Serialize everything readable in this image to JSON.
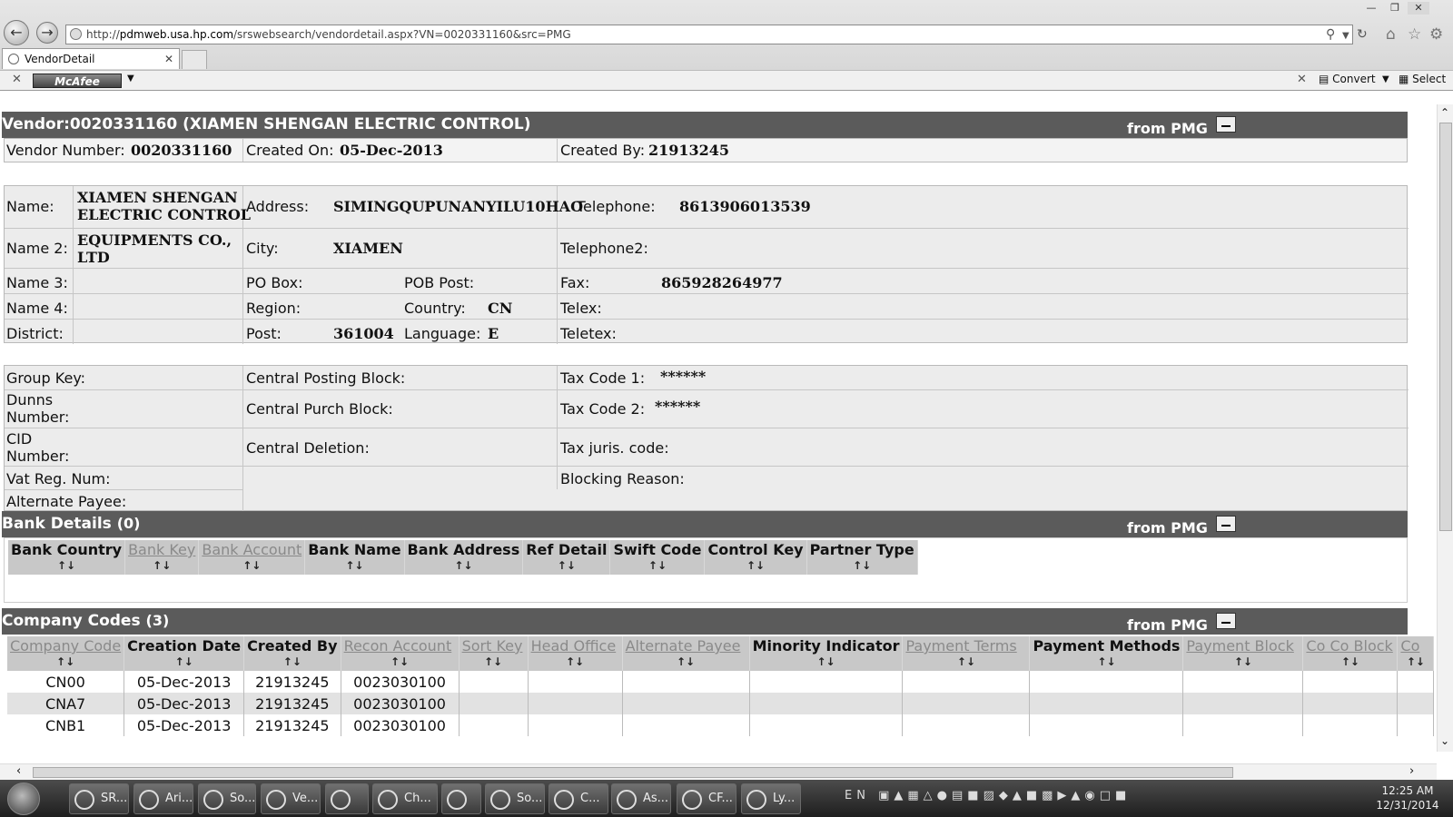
{
  "browser": {
    "url_prefix": "http://",
    "url_domain": "pdmweb.usa.hp.com",
    "url_path": "/srswebsearch/vendordetail.aspx?VN=0020331160&src=PMG",
    "tab_title": "VendorDetail",
    "toolbar_brand": "McAfee",
    "convert_label": "Convert",
    "select_label": "Select"
  },
  "vendor_header": {
    "title": "Vendor:0020331160 (XIAMEN SHENGAN ELECTRIC CONTROL)",
    "source": "from PMG"
  },
  "summary": {
    "vendor_number_label": "Vendor Number:",
    "vendor_number": "0020331160",
    "created_on_label": "Created On:",
    "created_on": "05-Dec-2013",
    "created_by_label": "Created By:",
    "created_by": "21913245"
  },
  "address": {
    "name_label": "Name:",
    "name": "XIAMEN SHENGAN ELECTRIC CONTROL",
    "name_line1": "XIAMEN SHENGAN",
    "name_line2": "ELECTRIC CONTROL",
    "address_label": "Address:",
    "address": "SIMINGQUPUNANYILU10HAO",
    "telephone_label": "Telephone:",
    "telephone": "8613906013539",
    "name2_label": "Name 2:",
    "name2_line1": "EQUIPMENTS CO.,",
    "name2_line2": "LTD",
    "city_label": "City:",
    "city": "XIAMEN",
    "telephone2_label": "Telephone2:",
    "name3_label": "Name 3:",
    "pobox_label": "PO Box:",
    "pobpost_label": "POB Post:",
    "fax_label": "Fax:",
    "fax": "865928264977",
    "name4_label": "Name 4:",
    "region_label": "Region:",
    "country_label": "Country:",
    "country": "CN",
    "telex_label": "Telex:",
    "district_label": "District:",
    "post_label": "Post:",
    "post": "361004",
    "language_label": "Language:",
    "language": "E",
    "teletex_label": "Teletex:"
  },
  "control": {
    "group_key_label": "Group Key:",
    "central_posting_label": "Central Posting Block:",
    "tax_code1_label": "Tax Code 1:",
    "tax_code1": "******",
    "dunns_label_1": "Dunns",
    "dunns_label_2": "Number:",
    "central_purch_label": "Central Purch Block:",
    "tax_code2_label": "Tax Code 2:",
    "tax_code2": "******",
    "cid_label_1": "CID",
    "cid_label_2": "Number:",
    "central_deletion_label": "Central Deletion:",
    "tax_juris_label": "Tax juris. code:",
    "vat_label": "Vat Reg. Num:",
    "blocking_label": "Blocking Reason:",
    "alt_payee_label": "Alternate Payee:"
  },
  "bank": {
    "title": "Bank Details",
    "count": "(0)",
    "source": "from PMG",
    "columns": [
      "Bank Country",
      "Bank Key",
      "Bank Account",
      "Bank Name",
      "Bank Address",
      "Ref Detail",
      "Swift Code",
      "Control Key",
      "Partner Type"
    ],
    "sort_arrows": "↑↓"
  },
  "company": {
    "title": "Company Codes",
    "count": "(3)",
    "source": "from PMG",
    "columns": [
      "Company Code",
      "Creation Date",
      "Created By",
      "Recon Account",
      "Sort Key",
      "Head Office",
      "Alternate Payee",
      "Minority Indicator",
      "Payment Terms",
      "Payment Methods",
      "Payment Block",
      "Co Co Block",
      "Co"
    ],
    "sort_arrows": "↑↓",
    "rows": [
      [
        "CN00",
        "05-Dec-2013",
        "21913245",
        "0023030100",
        "",
        "",
        "",
        "",
        "",
        "",
        "",
        "",
        ""
      ],
      [
        "CNA7",
        "05-Dec-2013",
        "21913245",
        "0023030100",
        "",
        "",
        "",
        "",
        "",
        "",
        "",
        "",
        ""
      ],
      [
        "CNB1",
        "05-Dec-2013",
        "21913245",
        "0023030100",
        "",
        "",
        "",
        "",
        "",
        "",
        "",
        "",
        ""
      ]
    ]
  },
  "taskbar": {
    "items": [
      "SR...",
      "Ari...",
      "So...",
      "Ve...",
      "",
      "Ch...",
      "",
      "So...",
      "C...",
      "As...",
      "CF...",
      "Ly..."
    ],
    "lang": "EN",
    "time": "12:25 AM",
    "date": "12/31/2014"
  }
}
